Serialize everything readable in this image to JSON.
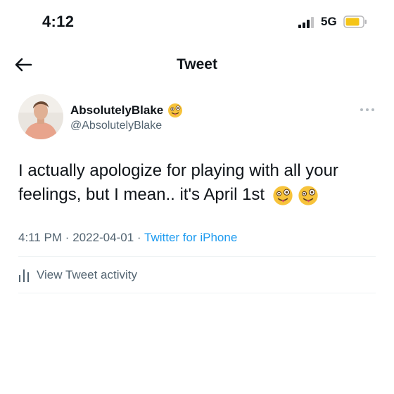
{
  "status_bar": {
    "time": "4:12",
    "network": "5G"
  },
  "nav": {
    "title": "Tweet"
  },
  "tweet": {
    "display_name": "AbsolutelyBlake",
    "handle": "@AbsolutelyBlake",
    "text": "I actually apologize for playing with all your feelings, but I mean.. it's April 1st",
    "time": "4:11 PM",
    "separator": "·",
    "date": "2022-04-01",
    "source": "Twitter for iPhone"
  },
  "activity": {
    "label": "View Tweet activity"
  },
  "colors": {
    "link": "#1d9bf0",
    "secondary_text": "#536471",
    "battery": "#f5c518",
    "divider": "#eff3f4"
  },
  "icons": [
    "back-arrow-icon",
    "signal-icon",
    "battery-icon",
    "zany-face-emoji",
    "more-icon",
    "analytics-icon"
  ]
}
